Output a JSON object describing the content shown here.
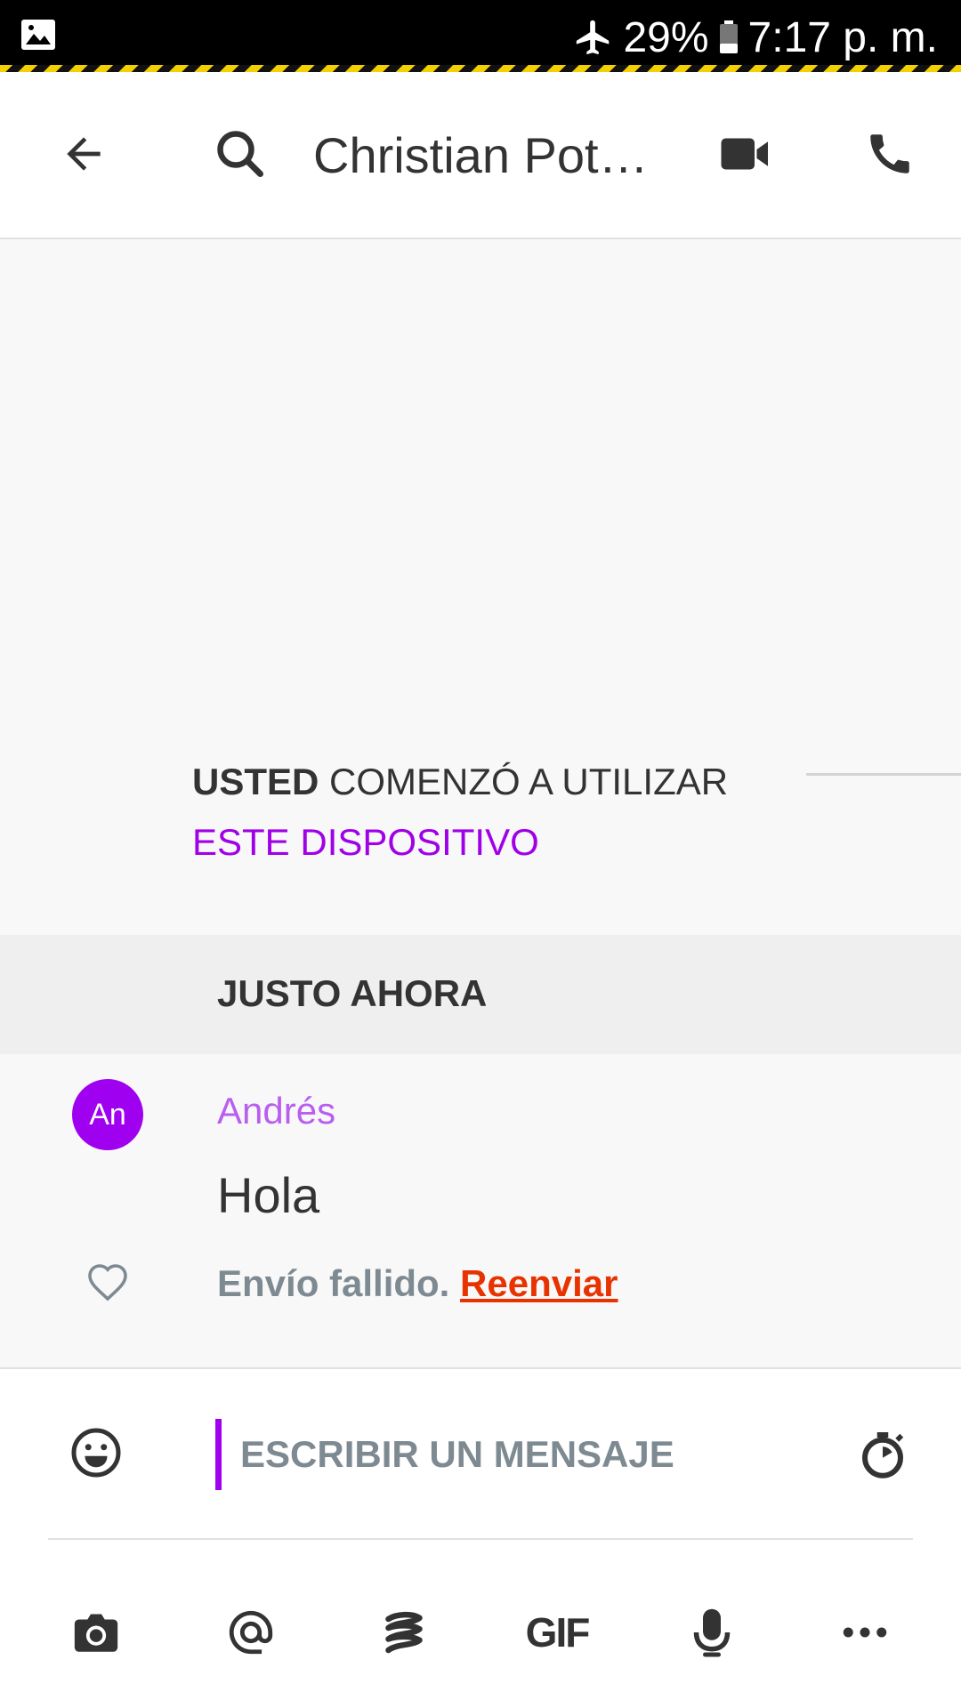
{
  "status_bar": {
    "battery": "29%",
    "time": "7:17 p. m.",
    "icons": [
      "gallery-icon",
      "airplane-icon",
      "battery-icon"
    ]
  },
  "top_bar": {
    "title": "Christian Pot…",
    "icons": [
      "back-arrow-icon",
      "search-icon",
      "video-call-icon",
      "phone-icon"
    ]
  },
  "conversation": {
    "system_message": {
      "bold": "USTED",
      "text": " COMENZÓ A UTILIZAR",
      "highlight": "ESTE DISPOSITIVO"
    },
    "date_separator": "JUSTO AHORA",
    "messages": [
      {
        "avatar_initials": "An",
        "sender": "Andrés",
        "text": "Hola",
        "status": "Envío fallido.",
        "action": "Reenviar"
      }
    ]
  },
  "composer": {
    "placeholder": "ESCRIBIR UN MENSAJE",
    "value": "",
    "gif_label": "GIF",
    "icons": [
      "emoji-icon",
      "timer-icon",
      "camera-icon",
      "mention-icon",
      "giphy-icon",
      "microphone-icon",
      "more-icon"
    ]
  },
  "colors": {
    "accent": "#a000f0",
    "sender": "#b95ff0",
    "error": "#e83300",
    "muted": "#7e8a92",
    "text": "#333333"
  }
}
